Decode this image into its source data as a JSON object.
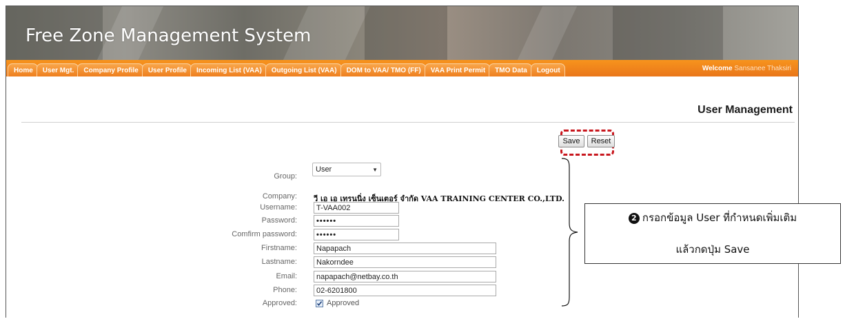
{
  "app": {
    "title": "Free Zone Management System"
  },
  "nav": {
    "tabs": [
      {
        "label": "Home"
      },
      {
        "label": "User Mgt."
      },
      {
        "label": "Company Profile"
      },
      {
        "label": "User Profile"
      },
      {
        "label": "Incoming List (VAA)"
      },
      {
        "label": "Outgoing List (VAA)"
      },
      {
        "label": "DOM to VAA/ TMO (FF)"
      },
      {
        "label": "VAA Print Permit"
      },
      {
        "label": "TMO Data"
      },
      {
        "label": "Logout"
      }
    ],
    "welcome_label": "Welcome",
    "welcome_user": "Sansanee Thaksiri"
  },
  "page": {
    "heading": "User Management"
  },
  "actions": {
    "save_label": "Save",
    "reset_label": "Reset"
  },
  "form": {
    "group": {
      "label": "Group:",
      "value": "User"
    },
    "company": {
      "label": "Company:",
      "value": "วี เอ เอ เทรนนิ่ง เซ็นเตอร์ จำกัด VAA TRAINING CENTER CO.,LTD."
    },
    "username": {
      "label": "Username:",
      "value": "T-VAA002"
    },
    "password": {
      "label": "Password:",
      "value": "••••••"
    },
    "confirm_password": {
      "label": "Comfirm password:",
      "value": "••••••"
    },
    "firstname": {
      "label": "Firstname:",
      "value": "Napapach"
    },
    "lastname": {
      "label": "Lastname:",
      "value": "Nakorndee"
    },
    "email": {
      "label": "Email:",
      "value": "napapach@netbay.co.th"
    },
    "phone": {
      "label": "Phone:",
      "value": "02-6201800"
    },
    "approved": {
      "label": "Approved:",
      "checkbox_label": "Approved",
      "checked": true
    }
  },
  "callout": {
    "step": "2",
    "line1": "กรอกข้อมูล User ที่กำหนดเพิ่มเติม",
    "line2": "แล้วกดปุ่ม Save"
  },
  "colors": {
    "nav_orange": "#f7941d",
    "highlight_red": "#c8161d"
  }
}
